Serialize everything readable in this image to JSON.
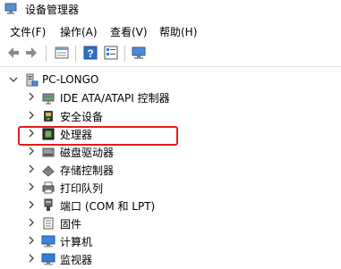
{
  "window": {
    "title": "设备管理器"
  },
  "menu": {
    "items": [
      {
        "label": "文件(F)"
      },
      {
        "label": "操作(A)"
      },
      {
        "label": "查看(V)"
      },
      {
        "label": "帮助(H)"
      }
    ]
  },
  "tree": {
    "root": {
      "label": "PC-LONGO",
      "expanded": true
    },
    "items": [
      {
        "label": "IDE ATA/ATAPI 控制器",
        "icon": "ide-controller-icon"
      },
      {
        "label": "安全设备",
        "icon": "security-device-icon"
      },
      {
        "label": "处理器",
        "icon": "processor-icon"
      },
      {
        "label": "磁盘驱动器",
        "icon": "disk-drive-icon"
      },
      {
        "label": "存储控制器",
        "icon": "storage-controller-icon"
      },
      {
        "label": "打印队列",
        "icon": "printer-icon"
      },
      {
        "label": "端口 (COM 和 LPT)",
        "icon": "port-icon",
        "highlighted": true
      },
      {
        "label": "固件",
        "icon": "firmware-icon"
      },
      {
        "label": "计算机",
        "icon": "computer-icon"
      },
      {
        "label": "监视器",
        "icon": "monitor-icon"
      }
    ]
  },
  "colors": {
    "highlight": "#e21c1c",
    "accent": "#1e74c6"
  }
}
